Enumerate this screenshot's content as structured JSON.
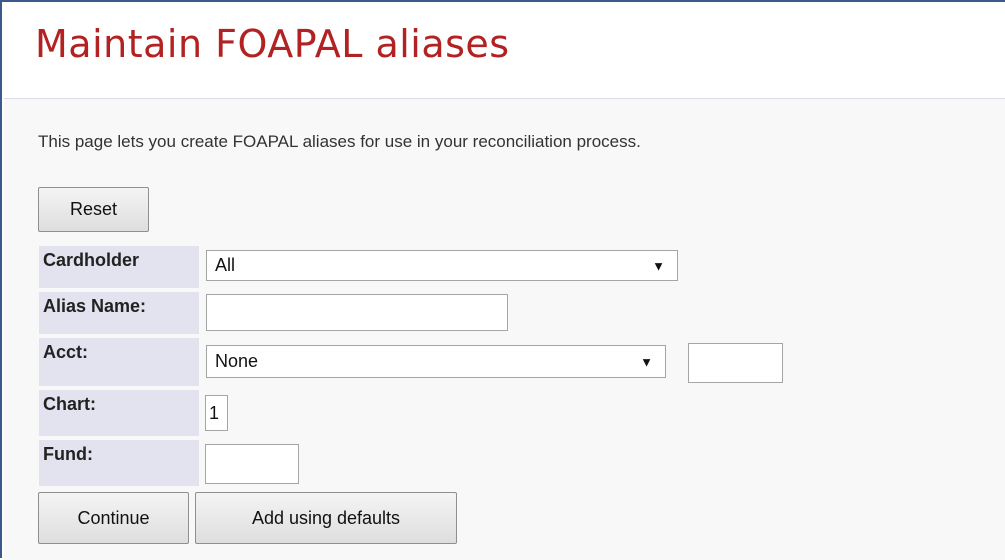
{
  "page": {
    "title": "Maintain FOAPAL aliases",
    "intro": "This page lets you create FOAPAL aliases for use in your reconciliation process."
  },
  "buttons": {
    "reset": "Reset",
    "continue": "Continue",
    "add_defaults": "Add using defaults"
  },
  "form": {
    "cardholder": {
      "label": "Cardholder",
      "selected": "All"
    },
    "alias_name": {
      "label": "Alias Name:",
      "value": ""
    },
    "acct": {
      "label": "Acct:",
      "selected": "None",
      "code_value": ""
    },
    "chart": {
      "label": "Chart:",
      "value": "1"
    },
    "fund": {
      "label": "Fund:",
      "value": ""
    }
  },
  "icons": {
    "dropdown": "chevron-down-icon"
  },
  "colors": {
    "title": "#b22222",
    "label_bg": "#e3e3ef",
    "frame_border": "#3a5a8c"
  }
}
